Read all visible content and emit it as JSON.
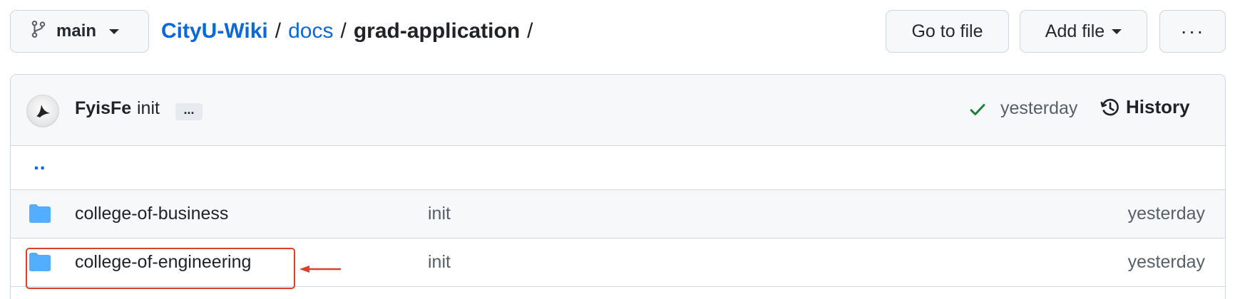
{
  "branch": {
    "name": "main",
    "icon": "git-branch-icon"
  },
  "breadcrumb": {
    "repo": "CityU-Wiki",
    "sep1": "/",
    "folder": "docs",
    "sep2": "/",
    "current": "grad-application",
    "sep3": "/"
  },
  "toolbar": {
    "go_to_file": "Go to file",
    "add_file": "Add file",
    "more": "···"
  },
  "commit": {
    "author": "FyisFe",
    "message": "init",
    "ellipsis": "...",
    "time": "yesterday",
    "history": "History",
    "status_icon": "check-icon",
    "status_color": "#1a7f37"
  },
  "files": {
    "parent": "..",
    "items": [
      {
        "name": "college-of-business",
        "message": "init",
        "date": "yesterday",
        "icon": "folder-icon"
      },
      {
        "name": "college-of-engineering",
        "message": "init",
        "date": "yesterday",
        "icon": "folder-icon"
      }
    ]
  },
  "colors": {
    "link": "#0969da",
    "folder": "#54aeff",
    "annotation": "#d9412c"
  }
}
